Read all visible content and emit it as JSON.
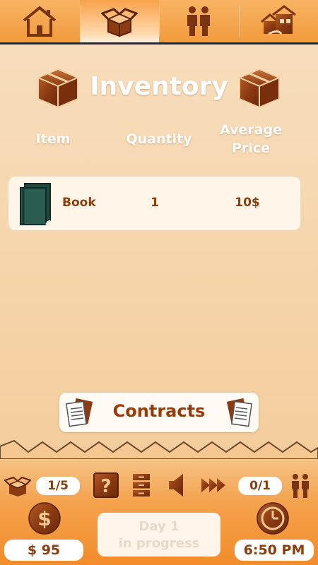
{
  "nav": {
    "tabs": [
      {
        "name": "home-tab",
        "icon": "house-icon",
        "active": false
      },
      {
        "name": "inventory-tab",
        "icon": "open-box-icon",
        "active": true
      },
      {
        "name": "employees-tab",
        "icon": "people-icon",
        "active": false
      },
      {
        "name": "properties-tab",
        "icon": "houses-icon",
        "active": false
      }
    ]
  },
  "page": {
    "title": "Inventory"
  },
  "table": {
    "headers": {
      "item": "Item",
      "quantity": "Quantity",
      "price_line1": "Average",
      "price_line2": "Price"
    },
    "rows": [
      {
        "icon": "book-icon",
        "name": "Book",
        "quantity": "1",
        "price": "10$"
      }
    ]
  },
  "contracts": {
    "label": "Contracts"
  },
  "status": {
    "inventory_capacity": "1/5",
    "employees": "0/1",
    "money": "$ 95",
    "day_line1": "Day 1",
    "day_line2": "in progress",
    "time": "6:50 PM"
  },
  "colors": {
    "accent": "#f39a3c",
    "text_brown": "#8a3e0e",
    "wood": "#8b3a12"
  }
}
